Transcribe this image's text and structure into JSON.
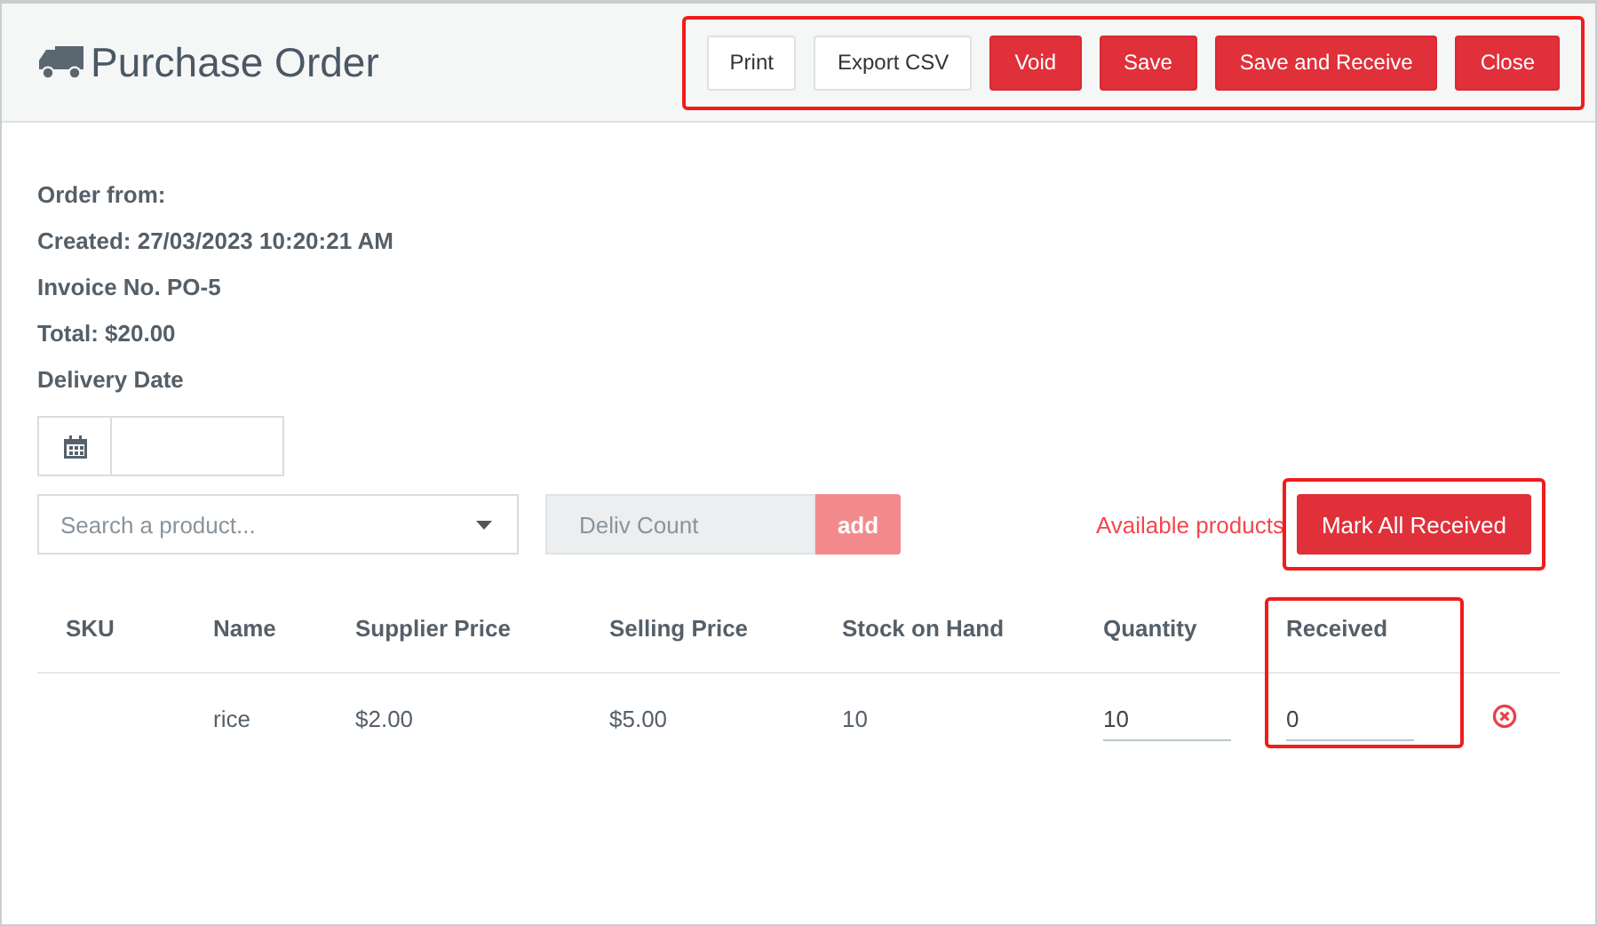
{
  "header": {
    "title": "Purchase Order"
  },
  "toolbar": {
    "highlighted": true,
    "buttons": [
      {
        "label": "Print",
        "kind": "default"
      },
      {
        "label": "Export CSV",
        "kind": "default"
      },
      {
        "label": "Void",
        "kind": "danger"
      },
      {
        "label": "Save",
        "kind": "danger"
      },
      {
        "label": "Save and Receive",
        "kind": "danger"
      },
      {
        "label": "Close",
        "kind": "danger"
      }
    ]
  },
  "details": [
    "Order from:",
    "Created: 27/03/2023 10:20:21 AM",
    "Invoice No. PO-5",
    "Total: $20.00",
    "Delivery Date"
  ],
  "product_search": {
    "placeholder": "Search a product..."
  },
  "deliv_count": {
    "placeholder": "Deliv Count"
  },
  "add_button": {
    "label": "add",
    "disabled": true
  },
  "available_products_link": "Available products",
  "mark_all_button": {
    "label": "Mark All Received",
    "highlighted": true
  },
  "table": {
    "columns": [
      {
        "label": "SKU",
        "highlighted": false
      },
      {
        "label": "Name",
        "highlighted": false
      },
      {
        "label": "Supplier Price",
        "highlighted": false
      },
      {
        "label": "Selling Price",
        "highlighted": false
      },
      {
        "label": "Stock on Hand",
        "highlighted": false
      },
      {
        "label": "Quantity",
        "highlighted": false
      },
      {
        "label": "Received",
        "highlighted": true
      }
    ],
    "rows": [
      {
        "sku": "",
        "name": "rice",
        "supplier_price": "$2.00",
        "selling_price": "$5.00",
        "stock_on_hand": "10",
        "quantity": "10",
        "received": "0"
      }
    ]
  }
}
